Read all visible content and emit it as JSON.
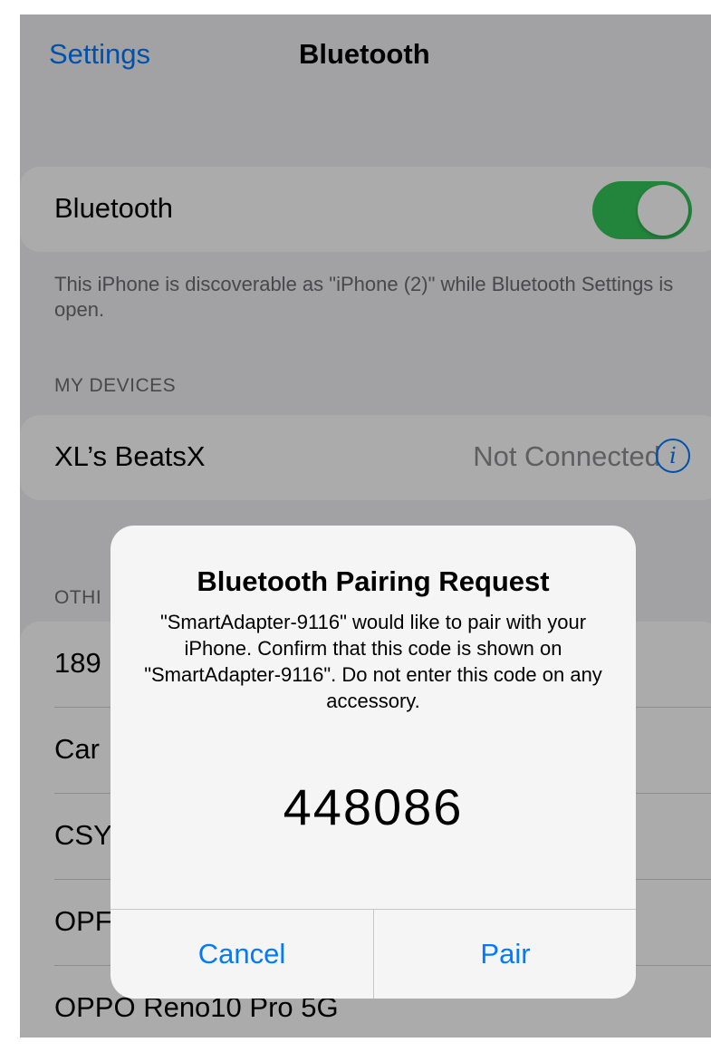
{
  "navbar": {
    "back_label": "Settings",
    "title": "Bluetooth"
  },
  "bluetooth_group": {
    "label": "Bluetooth",
    "toggle_on": true,
    "footer": "This iPhone is discoverable as \"iPhone (2)\" while Bluetooth Settings is open."
  },
  "my_devices": {
    "header": "MY DEVICES",
    "items": [
      {
        "name": "XL’s BeatsX",
        "status": "Not Connected",
        "info_glyph": "i"
      }
    ]
  },
  "other_devices": {
    "header_visible": "OTHI",
    "items": [
      {
        "name": "189"
      },
      {
        "name": "Car"
      },
      {
        "name": "CSY"
      },
      {
        "name": "OPF"
      },
      {
        "name": "OPPO Reno10 Pro 5G"
      }
    ]
  },
  "alert": {
    "title": "Bluetooth Pairing Request",
    "message": "\"SmartAdapter-9116\" would like to pair with your iPhone. Confirm that this code is shown on \"SmartAdapter-9116\". Do not enter this code on any accessory.",
    "code": "448086",
    "cancel_label": "Cancel",
    "pair_label": "Pair"
  },
  "colors": {
    "accent": "#007aff",
    "toggle_on": "#34c759",
    "background": "#f2f2f7"
  }
}
